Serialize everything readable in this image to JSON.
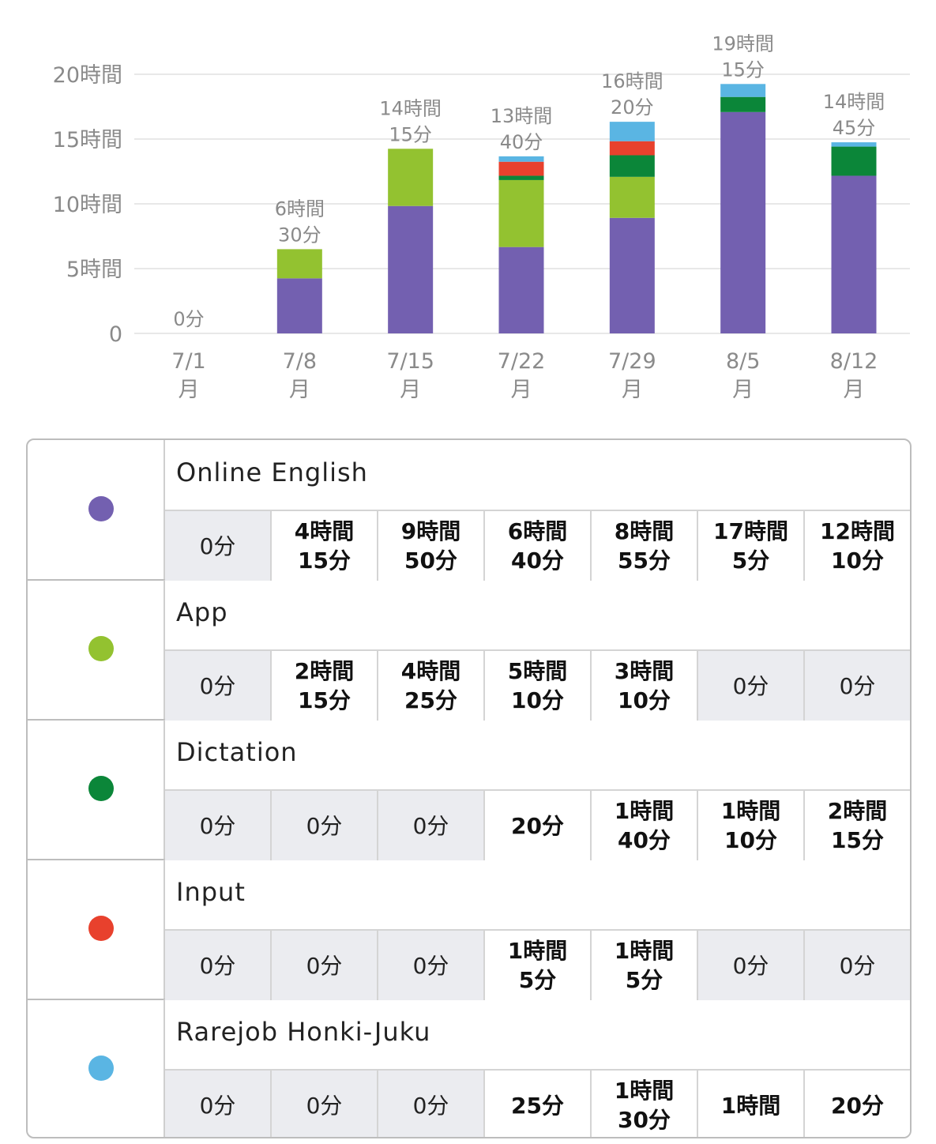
{
  "chart_data": {
    "type": "bar",
    "stacked": true,
    "categories": [
      {
        "date": "7/1",
        "weekday": "月"
      },
      {
        "date": "7/8",
        "weekday": "月"
      },
      {
        "date": "7/15",
        "weekday": "月"
      },
      {
        "date": "7/22",
        "weekday": "月"
      },
      {
        "date": "7/29",
        "weekday": "月"
      },
      {
        "date": "8/5",
        "weekday": "月"
      },
      {
        "date": "8/12",
        "weekday": "月"
      }
    ],
    "y_unit": "minutes",
    "ylim": [
      0,
      1200
    ],
    "yticks": [
      {
        "value": 0,
        "label": "0"
      },
      {
        "value": 300,
        "label": "5時間"
      },
      {
        "value": 600,
        "label": "10時間"
      },
      {
        "value": 900,
        "label": "15時間"
      },
      {
        "value": 1200,
        "label": "20時間"
      }
    ],
    "totals": [
      {
        "value": 0,
        "lines": [
          "0分"
        ]
      },
      {
        "value": 390,
        "lines": [
          "6時間",
          "30分"
        ]
      },
      {
        "value": 855,
        "lines": [
          "14時間",
          "15分"
        ]
      },
      {
        "value": 820,
        "lines": [
          "13時間",
          "40分"
        ]
      },
      {
        "value": 980,
        "lines": [
          "16時間",
          "20分"
        ]
      },
      {
        "value": 1155,
        "lines": [
          "19時間",
          "15分"
        ]
      },
      {
        "value": 885,
        "lines": [
          "14時間",
          "45分"
        ]
      }
    ],
    "series": [
      {
        "name": "Online English",
        "color": "#7360b0",
        "values": [
          0,
          255,
          590,
          400,
          535,
          1025,
          730
        ]
      },
      {
        "name": "App",
        "color": "#93c230",
        "values": [
          0,
          135,
          265,
          310,
          190,
          0,
          0
        ]
      },
      {
        "name": "Dictation",
        "color": "#0b8639",
        "values": [
          0,
          0,
          0,
          20,
          100,
          70,
          135
        ]
      },
      {
        "name": "Input",
        "color": "#e8412d",
        "values": [
          0,
          0,
          0,
          65,
          65,
          0,
          0
        ]
      },
      {
        "name": "Rarejob Honki-Juku",
        "color": "#5ab5e3",
        "values": [
          0,
          0,
          0,
          25,
          90,
          60,
          20
        ]
      }
    ],
    "grid": true,
    "legend": "none"
  },
  "breakdown": [
    {
      "name": "Online English",
      "color": "#7360b0",
      "cells": [
        "0分",
        "4時間\n15分",
        "9時間\n50分",
        "6時間\n40分",
        "8時間\n55分",
        "17時間\n5分",
        "12時間\n10分"
      ]
    },
    {
      "name": "App",
      "color": "#93c230",
      "cells": [
        "0分",
        "2時間\n15分",
        "4時間\n25分",
        "5時間\n10分",
        "3時間\n10分",
        "0分",
        "0分"
      ]
    },
    {
      "name": "Dictation",
      "color": "#0b8639",
      "cells": [
        "0分",
        "0分",
        "0分",
        "20分",
        "1時間\n40分",
        "1時間\n10分",
        "2時間\n15分"
      ]
    },
    {
      "name": "Input",
      "color": "#e8412d",
      "cells": [
        "0分",
        "0分",
        "0分",
        "1時間\n5分",
        "1時間\n5分",
        "0分",
        "0分"
      ]
    },
    {
      "name": "Rarejob Honki-Juku",
      "color": "#5ab5e3",
      "cells": [
        "0分",
        "0分",
        "0分",
        "25分",
        "1時間\n30分",
        "1時間",
        "20分"
      ]
    }
  ]
}
